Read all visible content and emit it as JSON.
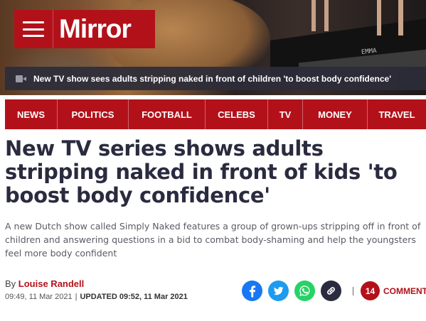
{
  "header": {
    "logo_text": "Mirror",
    "brand_color": "#b3111a",
    "video_caption": "New TV show sees adults stripping naked in front of children 'to boost body confidence'",
    "stage_sign": "EMMA"
  },
  "nav": {
    "items": [
      {
        "label": "NEWS"
      },
      {
        "label": "POLITICS"
      },
      {
        "label": "FOOTBALL"
      },
      {
        "label": "CELEBS"
      },
      {
        "label": "TV"
      },
      {
        "label": "MONEY"
      },
      {
        "label": "TRAVEL"
      }
    ]
  },
  "article": {
    "headline": "New TV series shows adults stripping naked in front of kids 'to boost body confidence'",
    "standfirst": "A new Dutch show called Simply Naked features a group of grown-ups stripping off in front of children and answering questions in a bid to combat body-shaming and help the youngsters feel more body confident",
    "byline_prefix": "By",
    "author": "Louise Randell",
    "published": "09:49, 11 Mar 2021",
    "date_separator": "|",
    "updated": "UPDATED 09:52, 11 Mar 2021"
  },
  "share": {
    "icons": [
      "facebook-icon",
      "twitter-icon",
      "whatsapp-icon",
      "link-icon"
    ],
    "colors": {
      "facebook": "#1877f2",
      "twitter": "#1d9bf0",
      "whatsapp": "#25d366",
      "link": "#2a2b3f"
    },
    "separator": "|",
    "comments_count": "14",
    "comments_label": "COMMENTS"
  }
}
